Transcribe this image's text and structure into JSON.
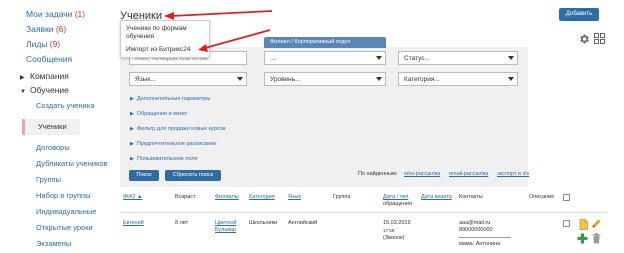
{
  "sidebar": {
    "my_tasks": {
      "label": "Мои задачи",
      "count": "(1)"
    },
    "requests": {
      "label": "Заявки",
      "count": "(6)"
    },
    "leads": {
      "label": "Лиды",
      "count": "(9)"
    },
    "messages": {
      "label": "Сообщения"
    },
    "company": {
      "label": "Компания"
    },
    "education": {
      "label": "Обучение"
    },
    "sub_items": [
      "Создать ученика",
      "Ученики",
      "Договоры",
      "Дубликаты учеников",
      "Группы",
      "Набор в группы",
      "Индивидуальные",
      "Открытые уроки",
      "Экзамены"
    ]
  },
  "header": {
    "title": "Ученики",
    "add_button": "Добавить"
  },
  "dropdown_menu": {
    "items": [
      "Ученики по формам обучения",
      "Импорт из Битрикс24"
    ]
  },
  "filters": {
    "search_placeholder": "Имя, телефон или email",
    "branch_label": "Филиал / Корпоративный отдел",
    "branch_value": "...",
    "status": "Статус...",
    "language": "Язык...",
    "level": "Уровень...",
    "category": "Категория...",
    "expanders": [
      "Дополнительные параметры",
      "Обращения и визит",
      "Фильтр для продажи новых курсов",
      "Предпочтительное расписание",
      "Пользовательские поля"
    ],
    "search_button": "Поиск",
    "reset_button": "Сбросить поиск",
    "found_label": "По найденным:",
    "found_links": [
      "sms-рассылка",
      "email-рассылка",
      "экспорт в xls"
    ]
  },
  "table": {
    "headers": {
      "name": "ФИО ▲",
      "age": "Возраст",
      "branches": "Филиалы",
      "category": "Категория",
      "language": "Язык",
      "group": "Группа",
      "contact_date_line1": "Дата / тип",
      "contact_date_line2": "обращения",
      "visit_date": "Дата визита",
      "contacts": "Контакты",
      "description": "Описание"
    },
    "rows": [
      {
        "name": "Евгений",
        "age": "8 лет",
        "branch_line1": "Цветной",
        "branch_line2": "Бульвар",
        "category": "Школьники",
        "language": "Английский",
        "date": "15.03.2019",
        "time": "17:59",
        "type": "(Звонок)",
        "email": "aaa@mail.ru",
        "phone": "89000000000",
        "contact_name": "мама: Антонина"
      }
    ]
  },
  "colors": {
    "link": "#2b6cb0",
    "button": "#2e6da4",
    "count": "#dd3333",
    "annotation_arrow": "#e02020",
    "plus_icon": "#2e9e44",
    "edit_icon": "#e8a21a"
  }
}
